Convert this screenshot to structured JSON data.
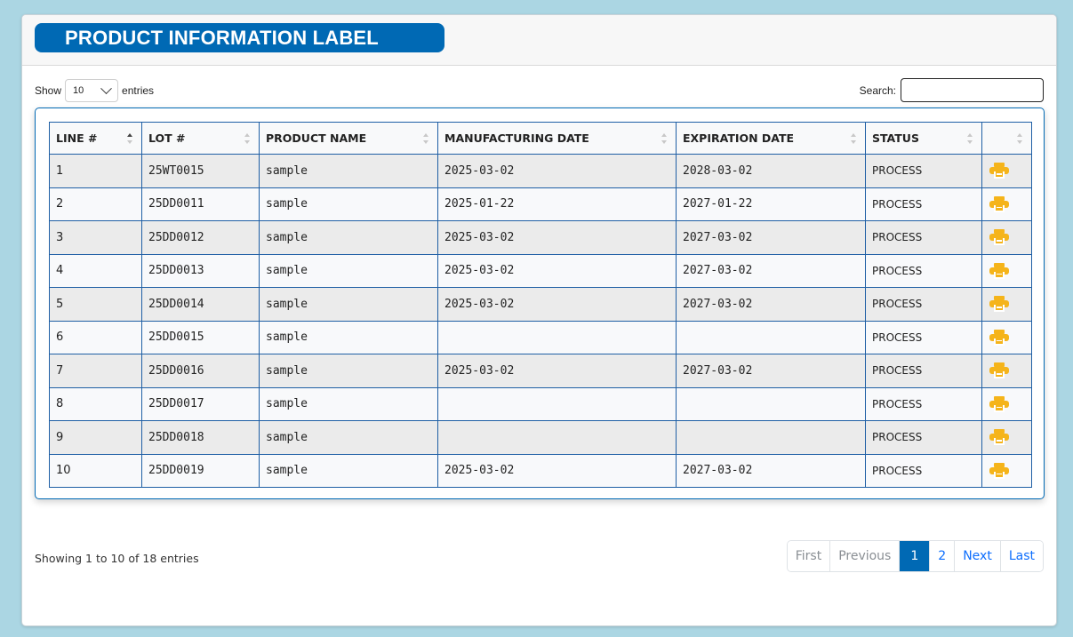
{
  "header": {
    "title": "PRODUCT INFORMATION LABEL"
  },
  "length": {
    "show_label": "Show",
    "value": "10",
    "entries_label": "entries"
  },
  "search": {
    "label": "Search:",
    "value": "",
    "placeholder": ""
  },
  "table": {
    "columns": [
      "LINE #",
      "LOT #",
      "PRODUCT NAME",
      "MANUFACTURING DATE",
      "EXPIRATION DATE",
      "STATUS",
      ""
    ],
    "rows": [
      [
        "1",
        "25WT0015",
        "sample",
        "2025-03-02",
        "2028-03-02",
        "PROCESS"
      ],
      [
        "2",
        "25DD0011",
        "sample",
        "2025-01-22",
        "2027-01-22",
        "PROCESS"
      ],
      [
        "3",
        "25DD0012",
        "sample",
        "2025-03-02",
        "2027-03-02",
        "PROCESS"
      ],
      [
        "4",
        "25DD0013",
        "sample",
        "2025-03-02",
        "2027-03-02",
        "PROCESS"
      ],
      [
        "5",
        "25DD0014",
        "sample",
        "2025-03-02",
        "2027-03-02",
        "PROCESS"
      ],
      [
        "6",
        "25DD0015",
        "sample",
        "",
        "",
        "PROCESS"
      ],
      [
        "7",
        "25DD0016",
        "sample",
        "2025-03-02",
        "2027-03-02",
        "PROCESS"
      ],
      [
        "8",
        "25DD0017",
        "sample",
        "",
        "",
        "PROCESS"
      ],
      [
        "9",
        "25DD0018",
        "sample",
        "",
        "",
        "PROCESS"
      ],
      [
        "10",
        "25DD0019",
        "sample",
        "2025-03-02",
        "2027-03-02",
        "PROCESS"
      ]
    ],
    "row_action_icon": "printer-icon"
  },
  "footer": {
    "info": "Showing 1 to 10 of 18 entries"
  },
  "pagination": {
    "first": "First",
    "previous": "Previous",
    "pages": [
      "1",
      "2"
    ],
    "current": "1",
    "next": "Next",
    "last": "Last"
  },
  "colors": {
    "background": "#abd6e3",
    "primary": "#0069b4",
    "print_icon": "#f5b41a",
    "table_border": "#1f5fa5"
  }
}
